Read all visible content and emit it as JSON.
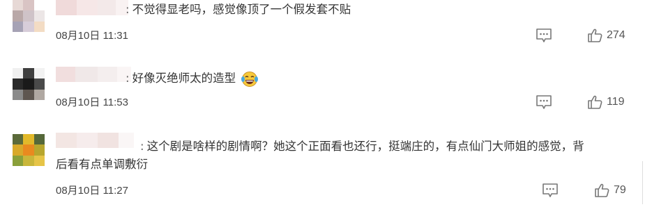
{
  "comments": [
    {
      "text": "不觉得显老吗，感觉像顶了一个假发套不贴",
      "time": "08月10日 11:31",
      "likes": "274",
      "emoji": ""
    },
    {
      "text": "好像灭绝师太的造型",
      "time": "08月10日 11:53",
      "likes": "119",
      "emoji": "laughing-tears-emoji"
    },
    {
      "text": "这个剧是啥样的剧情啊？她这个正面看也还行，挺端庄的，有点仙门大师姐的感觉，背",
      "text2": "后看有点单调敷衍",
      "time": "08月10日 11:27",
      "likes": "79",
      "emoji": ""
    }
  ],
  "colon": ":",
  "icons": {
    "comment": "comment-bubble-icon",
    "like": "thumbs-up-icon"
  },
  "colors": {
    "text": "#333333",
    "meta": "#444444",
    "icon": "#777777"
  }
}
